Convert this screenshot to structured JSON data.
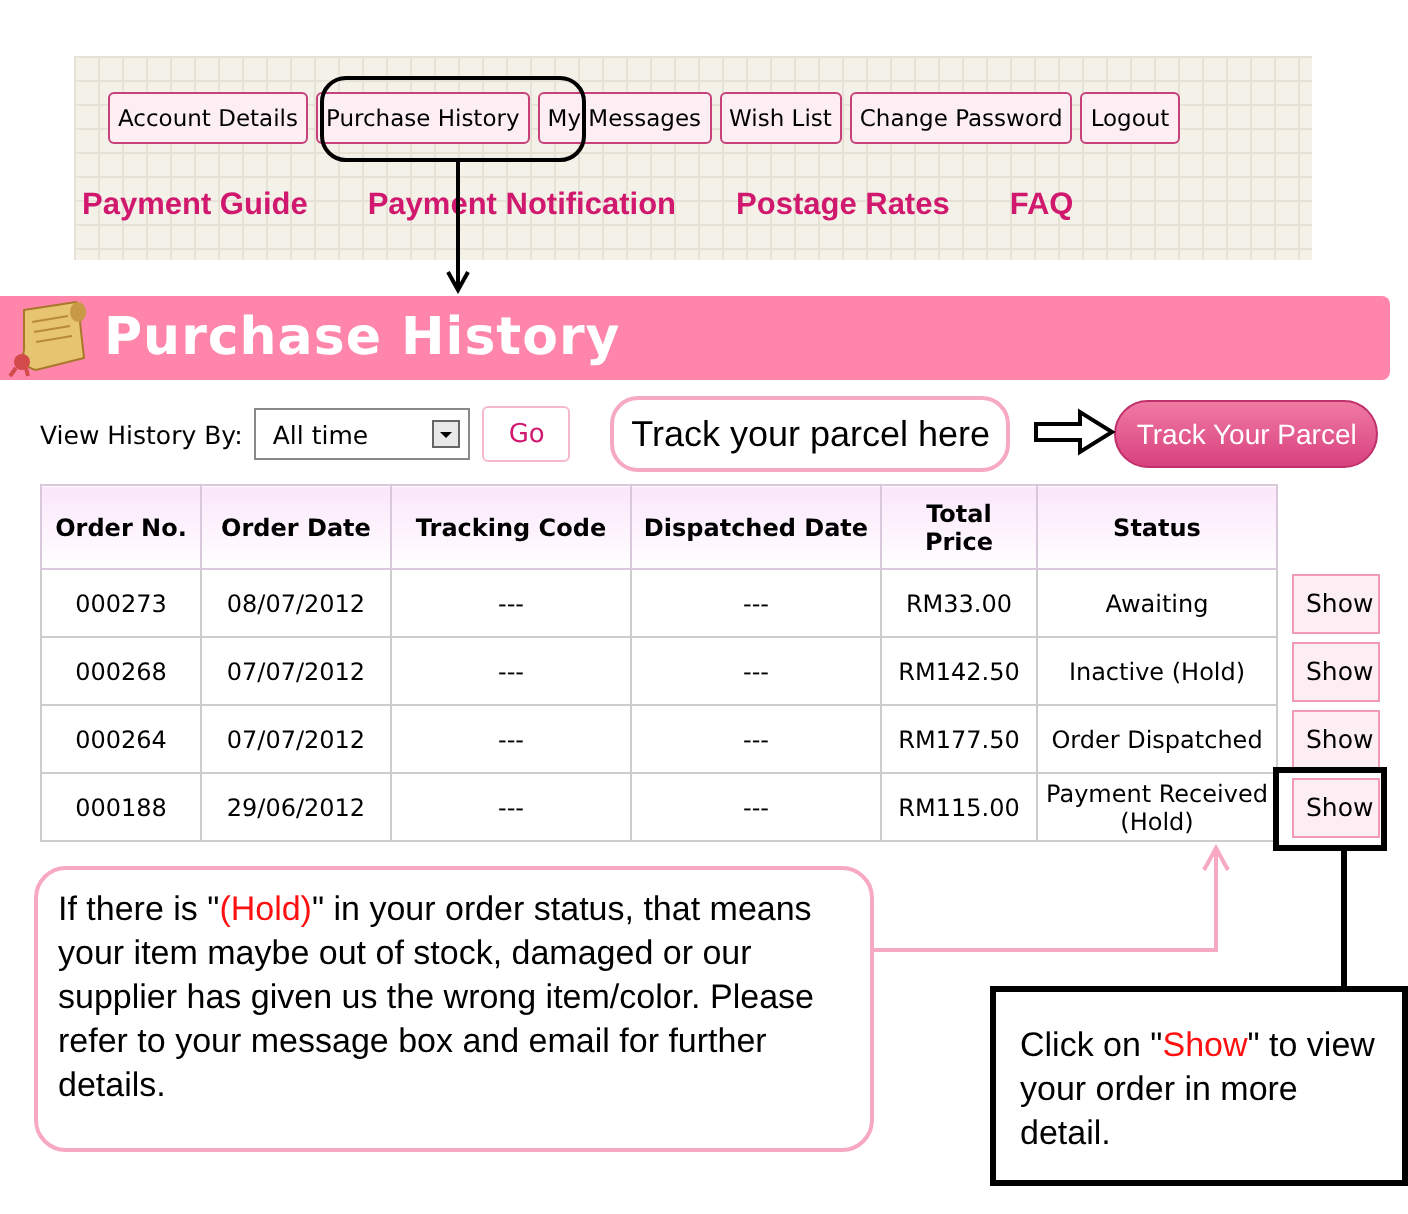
{
  "nav": {
    "buttons": [
      "Account Details",
      "Purchase History",
      "My Messages",
      "Wish List",
      "Change Password",
      "Logout"
    ],
    "links": [
      "Payment Guide",
      "Payment Notification",
      "Postage Rates",
      "FAQ"
    ]
  },
  "banner": {
    "title": "Purchase History"
  },
  "filter": {
    "label": "View History By:",
    "value": "All time",
    "go": "Go"
  },
  "track": {
    "callout": "Track your parcel here",
    "button": "Track Your Parcel"
  },
  "table": {
    "columns": [
      "Order No.",
      "Order Date",
      "Tracking Code",
      "Dispatched Date",
      "Total Price",
      "Status"
    ],
    "rows": [
      {
        "cells": [
          "000273",
          "08/07/2012",
          "---",
          "---",
          "RM33.00",
          "Awaiting"
        ],
        "action": "Show"
      },
      {
        "cells": [
          "000268",
          "07/07/2012",
          "---",
          "---",
          "RM142.50",
          "Inactive (Hold)"
        ],
        "action": "Show"
      },
      {
        "cells": [
          "000264",
          "07/07/2012",
          "---",
          "---",
          "RM177.50",
          "Order Dispatched"
        ],
        "action": "Show"
      },
      {
        "cells": [
          "000188",
          "29/06/2012",
          "---",
          "---",
          "RM115.00",
          "Payment Received (Hold)"
        ],
        "action": "Show"
      }
    ]
  },
  "hold_note": [
    {
      "text": "If there is \"",
      "red": false
    },
    {
      "text": "(Hold)",
      "red": true
    },
    {
      "text": "\" in your order status, that means your item maybe out of stock, damaged or our supplier has given us the wrong item/color. Please refer to your message box and email for further details.",
      "red": false
    }
  ],
  "show_note": [
    {
      "text": "Click on \"",
      "red": false
    },
    {
      "text": "Show",
      "red": true
    },
    {
      "text": "\" to view your order in more detail.",
      "red": false
    }
  ]
}
